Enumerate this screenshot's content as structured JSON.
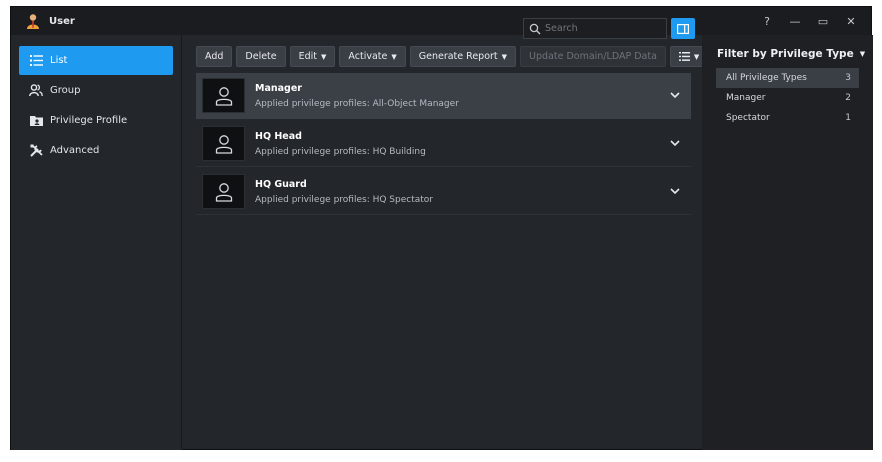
{
  "window": {
    "title": "User",
    "controls": [
      "?",
      "—",
      "▭",
      "✕"
    ]
  },
  "sidebar": {
    "items": [
      {
        "label": "List",
        "icon": "list-icon",
        "active": true
      },
      {
        "label": "Group",
        "icon": "group-icon",
        "active": false
      },
      {
        "label": "Privilege Profile",
        "icon": "privilege-profile-icon",
        "active": false
      },
      {
        "label": "Advanced",
        "icon": "tools-icon",
        "active": false
      }
    ]
  },
  "toolbar": {
    "add": "Add",
    "delete": "Delete",
    "edit": "Edit",
    "activate": "Activate",
    "generate_report": "Generate Report",
    "update_domain": "Update Domain/LDAP Data",
    "view_menu_icon": "list-view-icon",
    "search_placeholder": "Search"
  },
  "users": [
    {
      "name": "Manager",
      "profile": "Applied privilege profiles: All-Object Manager",
      "selected": true
    },
    {
      "name": "HQ Head",
      "profile": "Applied privilege profiles: HQ Building",
      "selected": false
    },
    {
      "name": "HQ Guard",
      "profile": "Applied privilege profiles: HQ Spectator",
      "selected": false
    }
  ],
  "filter": {
    "title": "Filter by Privilege Type",
    "items": [
      {
        "label": "All Privilege Types",
        "count": "3",
        "active": true
      },
      {
        "label": "Manager",
        "count": "2",
        "active": false
      },
      {
        "label": "Spectator",
        "count": "1",
        "active": false
      }
    ]
  },
  "colors": {
    "accent": "#1e9bf0",
    "background": "#23262b",
    "titlebar": "#1a1c1f"
  }
}
